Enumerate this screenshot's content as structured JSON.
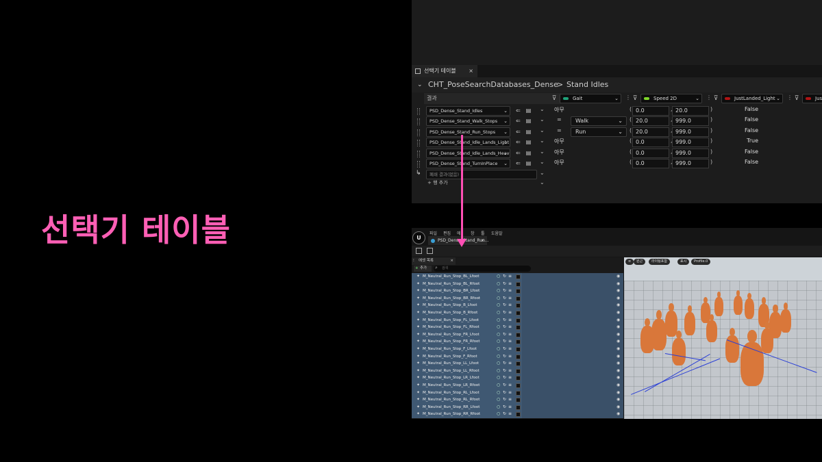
{
  "slide_title": "선택기 테이블",
  "chooser": {
    "tab_label": "선택기 테이블",
    "tab_close": "×",
    "breadcrumb_root": "CHT_PoseSearchDatabases_Dense",
    "breadcrumb_sep": ">",
    "breadcrumb_leaf": "Stand Idles",
    "result_header": "결과",
    "columns": [
      {
        "label": "Gait",
        "color": "#1fa37a"
      },
      {
        "label": "Speed 2D",
        "color": "#7fd62a"
      },
      {
        "label": "JustLanded_Light",
        "color": "#b01414"
      },
      {
        "label": "Jus",
        "color": "#b01414"
      }
    ],
    "rows": [
      {
        "asset": "PSD_Dense_Stand_Idles",
        "cond": "아무",
        "gait": "",
        "min": "0.0",
        "max": "20.0",
        "landed": "False"
      },
      {
        "asset": "PSD_Dense_Stand_Walk_Stops",
        "cond": "=",
        "gait": "Walk",
        "min": "20.0",
        "max": "999.0",
        "landed": "False"
      },
      {
        "asset": "PSD_Dense_Stand_Run_Stops",
        "cond": "=",
        "gait": "Run",
        "min": "20.0",
        "max": "999.0",
        "landed": "False"
      },
      {
        "asset": "PSD_Dense_Stand_Idle_Lands_Light",
        "cond": "아무",
        "gait": "",
        "min": "0.0",
        "max": "999.0",
        "landed": "True"
      },
      {
        "asset": "PSD_Dense_Stand_Idle_Lands_Heav",
        "cond": "아무",
        "gait": "",
        "min": "0.0",
        "max": "999.0",
        "landed": "False"
      },
      {
        "asset": "PSD_Dense_Stand_TurnInPlace",
        "cond": "아무",
        "gait": "",
        "min": "0.0",
        "max": "999.0",
        "landed": "False"
      }
    ],
    "fallback_placeholder": "폐쇄 결과(없음)",
    "add_row": "+ 행 추가"
  },
  "editor": {
    "logo": "U",
    "menu": [
      "파일",
      "편집",
      "에",
      "창",
      "툴",
      "도움말"
    ],
    "tab_label": "PSD_Dense_Stand_Run...",
    "tab_close": "×",
    "asset_browser_tab": "에셋 목록",
    "asset_browser_close": "×",
    "add_button": "추가",
    "search_placeholder": "검색",
    "assets": [
      "M_Neutral_Run_Stop_BL_Lfoot",
      "M_Neutral_Run_Stop_BL_Rfoot",
      "M_Neutral_Run_Stop_BR_Lfoot",
      "M_Neutral_Run_Stop_BR_Rfoot",
      "M_Neutral_Run_Stop_B_Lfoot",
      "M_Neutral_Run_Stop_B_Rfoot",
      "M_Neutral_Run_Stop_FL_Lfoot",
      "M_Neutral_Run_Stop_FL_Rfoot",
      "M_Neutral_Run_Stop_FR_Lfoot",
      "M_Neutral_Run_Stop_FR_Rfoot",
      "M_Neutral_Run_Stop_F_Lfoot",
      "M_Neutral_Run_Stop_F_Rfoot",
      "M_Neutral_Run_Stop_LL_Lfoot",
      "M_Neutral_Run_Stop_LL_Rfoot",
      "M_Neutral_Run_Stop_LR_Lfoot",
      "M_Neutral_Run_Stop_LR_Rfoot",
      "M_Neutral_Run_Stop_RL_Lfoot",
      "M_Neutral_Run_Stop_RL_Rfoot",
      "M_Neutral_Run_Stop_RR_Lfoot",
      "M_Neutral_Run_Stop_RR_Rfoot"
    ],
    "viewport_buttons": [
      "원근",
      "라이팅포함",
      "표시",
      "Profile.0"
    ]
  },
  "colors": {
    "accent_pink": "#ff5fb5",
    "selection_blue": "#3f5872"
  }
}
